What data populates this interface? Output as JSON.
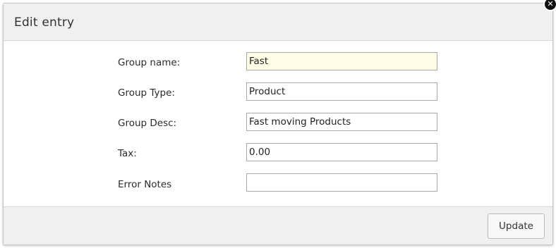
{
  "dialog": {
    "title": "Edit entry",
    "close_icon": "close-icon"
  },
  "form": {
    "fields": [
      {
        "label": "Group name:",
        "value": "Fast",
        "focused": true
      },
      {
        "label": "Group Type:",
        "value": "Product"
      },
      {
        "label": "Group Desc:",
        "value": "Fast moving Products"
      },
      {
        "label": "Tax:",
        "value": "0.00"
      },
      {
        "label": "Error Notes",
        "value": ""
      }
    ]
  },
  "footer": {
    "update_label": "Update"
  },
  "colors": {
    "focused_input_bg": "#fffde6",
    "header_bg": "#f0f0f0",
    "close_bg": "#111111"
  }
}
